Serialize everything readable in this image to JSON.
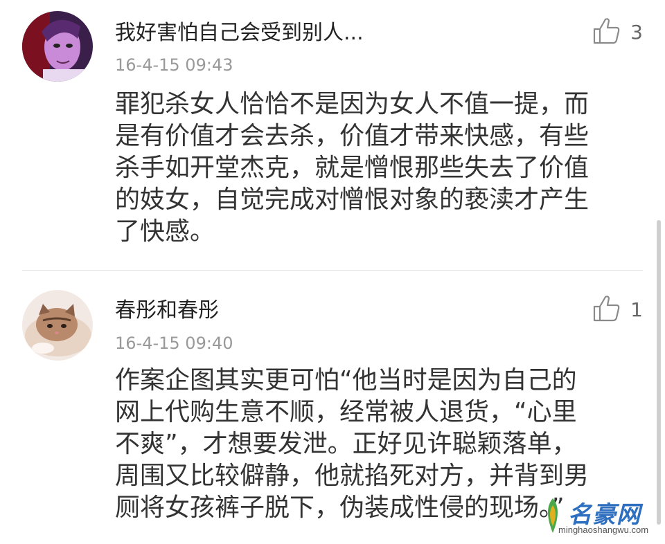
{
  "comments": [
    {
      "username": "我好害怕自己会受到别人...",
      "time": "16-4-15 09:43",
      "likes": "3",
      "text": "罪犯杀女人恰恰不是因为女人不值一提，而\n是有价值才会去杀，价值才带来快感，有些\n杀手如开堂杰克，就是憎恨那些失去了价值\n的妓女，自觉完成对憎恨对象的亵渎才产生\n了快感。"
    },
    {
      "username": "春彤和春彤",
      "time": "16-4-15 09:40",
      "likes": "1",
      "text": "作案企图其实更可怕“他当时是因为自己的\n网上代购生意不顺，经常被人退货，“心里\n不爽”，才想要发泄。正好见许聪颖落单，\n周围又比较僻静，他就掐死对方，并背到男\n厕将女孩裤子脱下，伪装成性侵的现场。”"
    }
  ],
  "watermark": {
    "brand": "名豪网",
    "url": "minghaoshangwu.com"
  },
  "icons": {
    "like": "thumbs-up-icon"
  }
}
